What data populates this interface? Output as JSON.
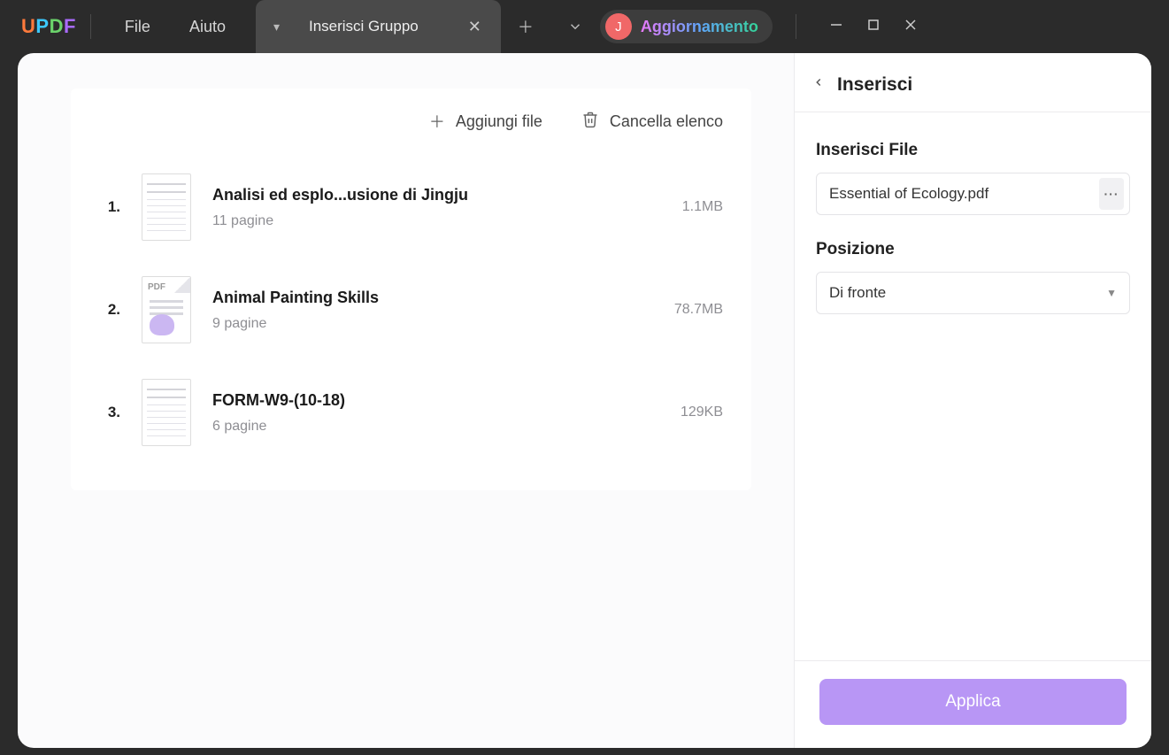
{
  "menu": {
    "file": "File",
    "help": "Aiuto"
  },
  "tab": {
    "title": "Inserisci Gruppo"
  },
  "user": {
    "initial": "J",
    "upgrade": "Aggiornamento"
  },
  "toolbar": {
    "add": "Aggiungi file",
    "clear": "Cancella elenco"
  },
  "files": [
    {
      "num": "1.",
      "title": "Analisi ed esplo...usione di Jingju",
      "pages": "11 pagine",
      "size": "1.1MB",
      "thumb": "doc"
    },
    {
      "num": "2.",
      "title": "Animal Painting Skills",
      "pages": "9 pagine",
      "size": "78.7MB",
      "thumb": "pdf"
    },
    {
      "num": "3.",
      "title": "FORM-W9-(10-18)",
      "pages": "6 pagine",
      "size": "129KB",
      "thumb": "doc"
    }
  ],
  "side": {
    "title": "Inserisci",
    "file_label": "Inserisci File",
    "file_value": "Essential of Ecology.pdf",
    "pos_label": "Posizione",
    "pos_value": "Di fronte",
    "apply": "Applica"
  }
}
